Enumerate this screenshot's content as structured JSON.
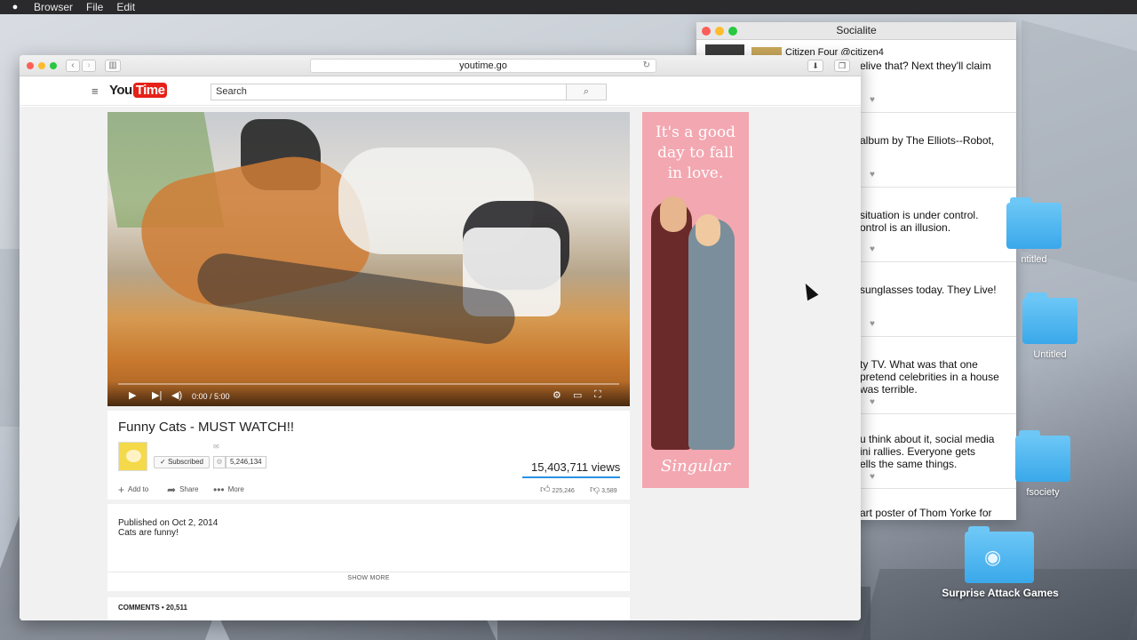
{
  "menubar": {
    "apple_icon": "apple-icon",
    "items": [
      "Browser",
      "File",
      "Edit"
    ]
  },
  "socialite": {
    "title": "Socialite",
    "feed": [
      {
        "user": "Citizen Four  @citizen4",
        "lines": [
          "elive that?  Next they'll claim"
        ]
      },
      {
        "lines": [
          "album by The Elliots--Robot,"
        ]
      },
      {
        "lines": [
          "situation is under control.",
          "ontrol is an illusion."
        ]
      },
      {
        "lines": [
          "sunglasses today.  They Live!"
        ]
      },
      {
        "lines": [
          "ty TV.  What was that one",
          "pretend celebrities in a house",
          "was terrible."
        ]
      },
      {
        "lines": [
          "u think about it, social media",
          "ini rallies. Everyone gets",
          "ells the same things."
        ]
      },
      {
        "lines": [
          "art poster of Thom Yorke for"
        ]
      }
    ]
  },
  "desktop": {
    "folders": [
      {
        "label": "ntitled"
      },
      {
        "label": "Untitled"
      },
      {
        "label": "fsociety"
      }
    ],
    "game_folder": {
      "label": "Surprise Attack Games",
      "icon": "gamepad-icon"
    }
  },
  "browser": {
    "url": "youtime.go",
    "logo": {
      "part1": "You",
      "part2": "Time"
    },
    "search": {
      "placeholder": "Search",
      "button_icon": "search-icon"
    }
  },
  "video": {
    "time": "0:00 / 5:00",
    "progress": 0.0,
    "title": "Funny Cats - MUST WATCH!!",
    "channel": {
      "subscribe_label": "Subscribed",
      "subscriber_count": "5,246,134"
    },
    "views": "15,403,711 views",
    "actions": {
      "add_to": "Add to",
      "share": "Share",
      "more": "More"
    },
    "likes": "225,246",
    "dislikes": "3,589",
    "published": "Published on Oct 2, 2014",
    "description": "Cats are funny!",
    "show_more": "SHOW MORE",
    "comments": "COMMENTS • 20,511"
  },
  "ad": {
    "line1": "It's a good",
    "line2": "day  to fall",
    "line3": "in love.",
    "brand": "Singular",
    "bg_color": "#f3a7b1"
  },
  "colors": {
    "brand_red": "#e62117",
    "views_bar": "#2793e6",
    "folder_blue": "#3aa8ea"
  }
}
